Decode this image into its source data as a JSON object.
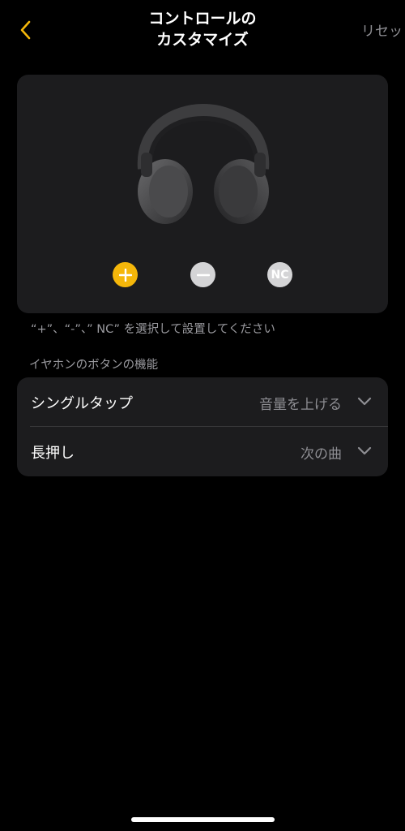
{
  "header": {
    "back_icon": "chevron-left-icon",
    "title_line1": "コントロールの",
    "title_line2": "カスタマイズ",
    "reset_label": "リセット"
  },
  "device": {
    "image": "headphones-image",
    "buttons": [
      {
        "label": "+",
        "icon": "plus-icon",
        "selected": true,
        "color": "#f5b70a"
      },
      {
        "label": "−",
        "icon": "minus-icon",
        "selected": false,
        "color": "#d4d4d6"
      },
      {
        "label": "NC",
        "icon": "nc-icon",
        "selected": false,
        "color": "#d4d4d6"
      }
    ]
  },
  "hint": "“+”、“-”、” NC” を選択して設置してください",
  "section_label": "イヤホンのボタンの機能",
  "settings": [
    {
      "label": "シングルタップ",
      "value": "音量を上げる",
      "icon": "chevron-down-icon"
    },
    {
      "label": "長押し",
      "value": "次の曲",
      "icon": "chevron-down-icon"
    }
  ],
  "colors": {
    "accent": "#f5b70a",
    "background": "#000000",
    "card": "#1c1c1e",
    "secondary_text": "#8e8e93"
  }
}
